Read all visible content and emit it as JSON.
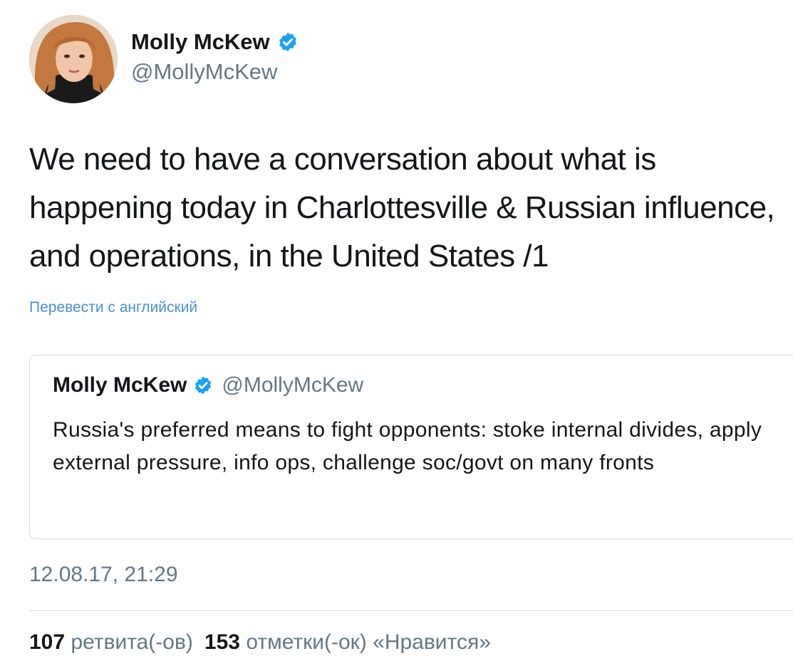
{
  "tweet": {
    "author_name": "Molly McKew",
    "handle": "@MollyMcKew",
    "verified_icon": "verified-badge-icon",
    "text": "We need to have a conversation about what is happening today in Charlottesville & Russian influence, and operations, in the United States /1",
    "translate_link": "Перевести с английский",
    "timestamp": "12.08.17, 21:29",
    "colors": {
      "link": "#4a90d9",
      "verified": "#1da1f2",
      "secondary_text": "#657786"
    }
  },
  "quoted_tweet": {
    "author_name": "Molly McKew",
    "handle": "@MollyMcKew",
    "text": "Russia's preferred means to fight opponents: stoke internal divides, apply external pressure, info ops, challenge soc/govt on many fronts"
  },
  "stats": {
    "retweets_count": "107",
    "retweets_label": "ретвита(-ов)",
    "likes_count": "153",
    "likes_label": "отметки(-ок) «Нравится»"
  }
}
